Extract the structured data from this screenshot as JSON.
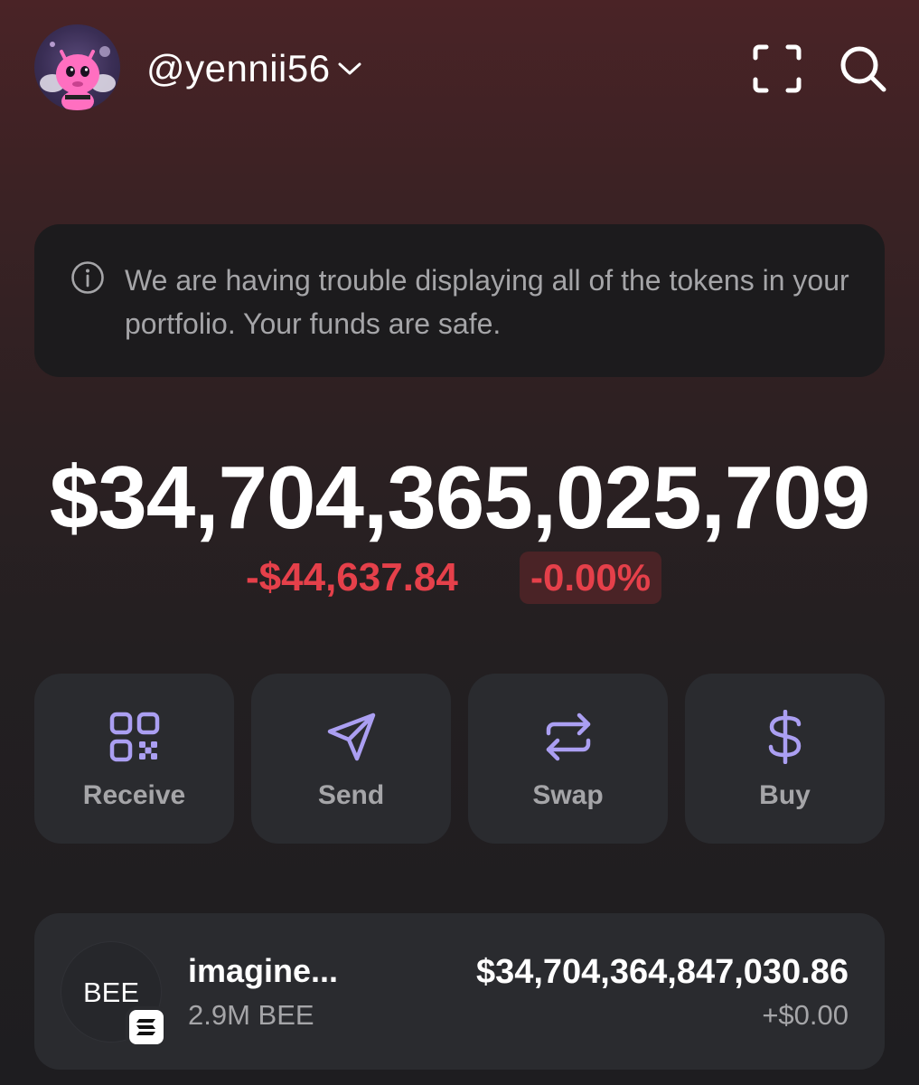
{
  "header": {
    "username": "@yennii56",
    "icons": [
      "avatar",
      "chevron-down-icon",
      "scan-icon",
      "search-icon"
    ]
  },
  "notice": {
    "icon": "info-icon",
    "text": "We are having trouble displaying all of the tokens in your portfolio. Your funds are safe."
  },
  "portfolio": {
    "balance": "$34,704,365,025,709",
    "change_amount": "-$44,637.84",
    "change_percent": "-0.00%"
  },
  "actions": [
    {
      "label": "Receive",
      "icon": "qr-code-icon"
    },
    {
      "label": "Send",
      "icon": "send-icon"
    },
    {
      "label": "Swap",
      "icon": "swap-icon"
    },
    {
      "label": "Buy",
      "icon": "dollar-icon"
    }
  ],
  "tokens": [
    {
      "logo_text": "BEE",
      "name": "imagine...",
      "amount": "2.9M BEE",
      "value": "$34,704,364,847,030.86",
      "change": "+$0.00",
      "chain_icon": "solana-icon"
    }
  ],
  "colors": {
    "accent": "#ab9ff2",
    "negative": "#e5404a",
    "card": "#2a2b2f",
    "muted_text": "#a5a5a8"
  }
}
